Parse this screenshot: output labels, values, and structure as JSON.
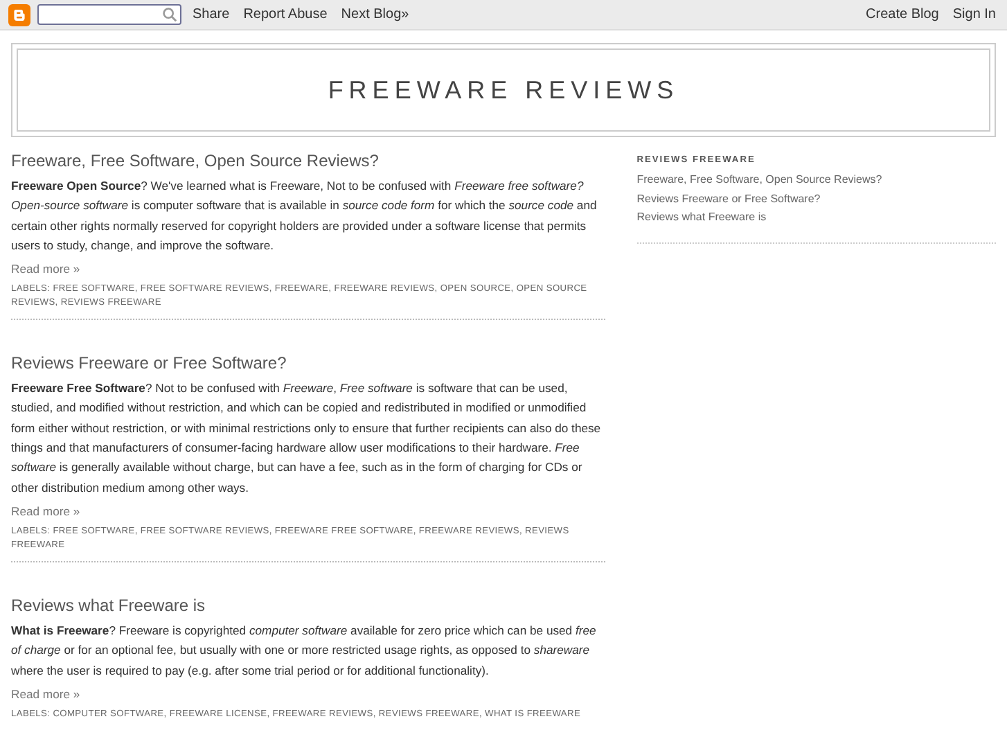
{
  "navbar": {
    "links": [
      "Share",
      "Report Abuse",
      "Next Blog»"
    ],
    "right_links": [
      "Create Blog",
      "Sign In"
    ]
  },
  "header": {
    "title": "FREEWARE REVIEWS"
  },
  "posts": [
    {
      "title": "Freeware, Free Software, Open Source Reviews?",
      "body": "**Freeware Open Source**? We've learned what is Freeware, Not to be confused with *Freeware free software? Open-source software* is computer software that is available in *source code form* for which the *source code* and certain other rights normally reserved for copyright holders are provided under a software license that permits users to study, change, and improve the software.",
      "read_more": "Read more »",
      "labels": "LABELS: FREE SOFTWARE, FREE SOFTWARE REVIEWS, FREEWARE, FREEWARE REVIEWS, OPEN SOURCE, OPEN SOURCE REVIEWS, REVIEWS FREEWARE"
    },
    {
      "title": "Reviews Freeware or Free Software?",
      "body": "**Freeware Free Software**? Not to be confused with *Freeware*, *Free software* is software that can be used, studied, and modified without restriction, and which can be copied and redistributed in modified or unmodified form either without restriction, or with minimal restrictions only to ensure that further recipients can also do these things and that manufacturers of consumer-facing hardware allow user modifications to their hardware. *Free software* is generally available without charge, but can have a fee, such as in the form of charging for CDs or other distribution medium among other ways.",
      "read_more": "Read more »",
      "labels": "LABELS: FREE SOFTWARE, FREE SOFTWARE REVIEWS, FREEWARE FREE SOFTWARE, FREEWARE REVIEWS, REVIEWS FREEWARE"
    },
    {
      "title": "Reviews what Freeware is",
      "body": "**What is Freeware**? Freeware is copyrighted *computer software* available for zero price which can be used *free of charge* or for an optional fee, but usually with one or more restricted usage rights, as opposed to *shareware* where the user is required to pay (e.g. after some trial period or for additional functionality).",
      "read_more": "Read more »",
      "labels": "LABELS: COMPUTER SOFTWARE, FREEWARE LICENSE, FREEWARE REVIEWS, REVIEWS FREEWARE, WHAT IS FREEWARE"
    }
  ],
  "sidebar": {
    "heading": "REVIEWS FREEWARE",
    "links": [
      "Freeware, Free Software, Open Source Reviews?",
      "Reviews Freeware or Free Software?",
      "Reviews what Freeware is"
    ]
  }
}
